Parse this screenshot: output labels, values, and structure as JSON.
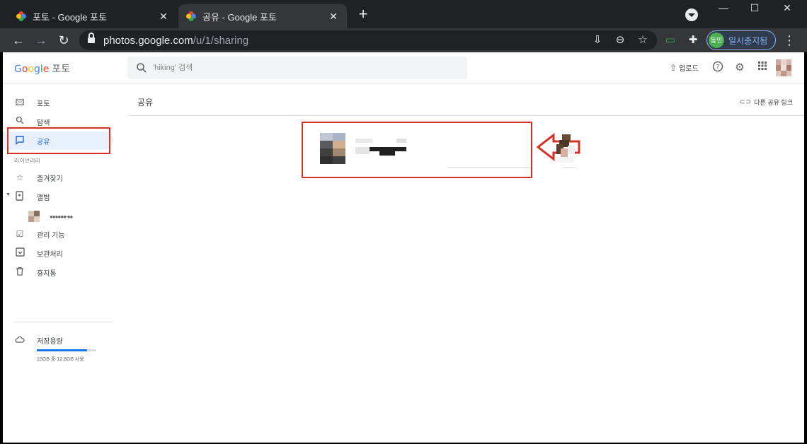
{
  "browser": {
    "tabs": [
      {
        "title": "포토 - Google 포토",
        "active": false
      },
      {
        "title": "공유 - Google 포토",
        "active": true
      }
    ],
    "new_tab": "+",
    "url_host": "photos.google.com",
    "url_path": "/u/1/sharing",
    "profile_avatar": "동민",
    "profile_label": "일시중지됨",
    "window_controls": [
      "—",
      "☐",
      "✕"
    ],
    "accent_color": "#8ab4f8"
  },
  "app": {
    "logo_letters": [
      "G",
      "o",
      "o",
      "g",
      "l",
      "e"
    ],
    "product": "포토",
    "search_placeholder": "'hiking' 검색",
    "upload_label": "업로드",
    "icons": [
      "help-icon",
      "settings-icon",
      "apps-grid-icon",
      "user-avatar"
    ]
  },
  "sidebar": {
    "items": [
      {
        "label": "포토",
        "icon": "photo-icon"
      },
      {
        "label": "탐색",
        "icon": "search-icon"
      },
      {
        "label": "공유",
        "icon": "sharing-icon",
        "active": true
      }
    ],
    "library_label": "라이브러리",
    "library_items": [
      {
        "label": "즐겨찾기",
        "icon": "star-icon"
      },
      {
        "label": "앨범",
        "icon": "album-icon"
      }
    ],
    "album_child": "●●●●●●-●●",
    "more_items": [
      {
        "label": "관리 기능",
        "icon": "utilities-icon"
      },
      {
        "label": "보관처리",
        "icon": "archive-icon"
      },
      {
        "label": "휴지통",
        "icon": "trash-icon"
      }
    ],
    "storage_label": "저장용량",
    "storage_text": "15GB 중 12.8GB 사용",
    "storage_used_fraction": 0.85
  },
  "main": {
    "title": "공유",
    "other_links": "다른 공유 링크"
  },
  "colors": {
    "highlight": "#d93025",
    "active_bg": "#e8f0fe",
    "active_text": "#1967d2"
  }
}
